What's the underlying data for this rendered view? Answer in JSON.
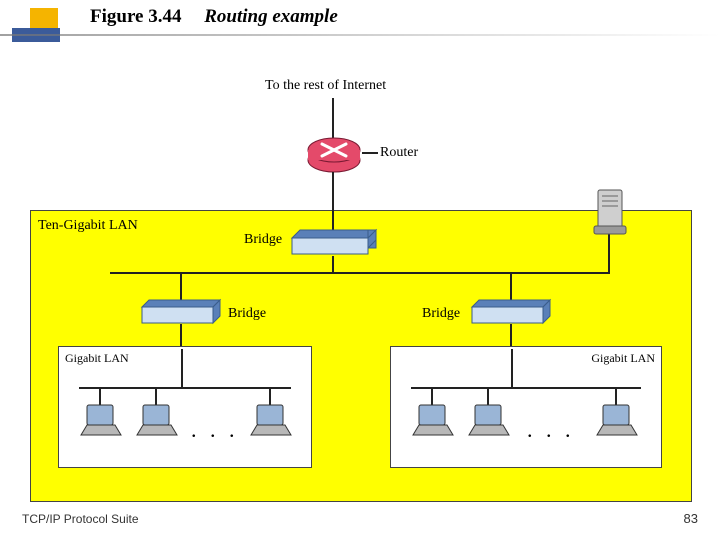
{
  "title": {
    "figure_number": "Figure 3.44",
    "caption": "Routing example"
  },
  "diagram": {
    "top_label": "To the rest of Internet",
    "router_label": "Router",
    "backbone_label": "Ten-Gigabit LAN",
    "bridge_label_top": "Bridge",
    "bridge_label_left": "Bridge",
    "bridge_label_right": "Bridge",
    "left_segment_label": "Gigabit LAN",
    "right_segment_label": "Gigabit LAN",
    "left_ellipsis": ". . .",
    "right_ellipsis": ". . ."
  },
  "footer": {
    "left": "TCP/IP Protocol Suite",
    "page": "83"
  },
  "colors": {
    "backbone_bg": "#ffff00",
    "router": "#e44a6a",
    "bridge_top": "#cfe0f2",
    "bridge_side": "#5a80b8"
  }
}
